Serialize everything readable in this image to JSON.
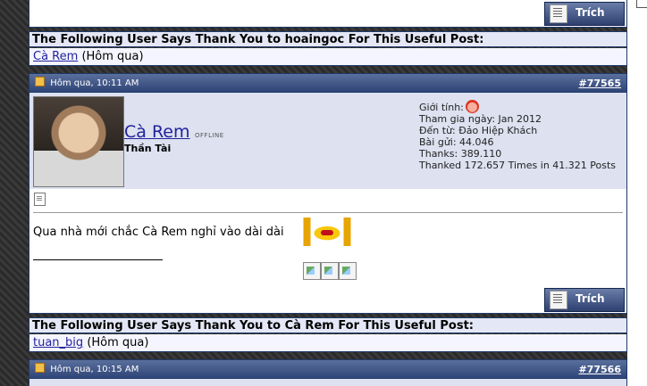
{
  "top_post": {
    "quote_button_label": "Trích"
  },
  "thanks_1": {
    "header": "The Following User Says Thank You to hoaingoc For This Useful Post:",
    "user": "Cà Rem",
    "when": "(Hôm qua)"
  },
  "post": {
    "date": "Hôm qua, 10:11 AM",
    "number_hash": "#",
    "number": "77565",
    "username": "Cà Rem",
    "status": "OFFLINE",
    "user_title": "Thần Tài",
    "info": {
      "gender_label": "Giới tính:",
      "join_date": "Tham gia ngày: Jan 2012",
      "location": "Đến từ: Đảo Hiệp Khách",
      "posts": "Bài gửi: 44.046",
      "thanks": "Thanks: 389.110",
      "thanked": "Thanked 172.657 Times in 41.321 Posts"
    },
    "message": "Qua nhà mới chắc Cà Rem nghỉ vào dài dài",
    "quote_button_label": "Trích",
    "icons": {
      "post_icon": "doc-icon",
      "emoticon": "angry-emoticon",
      "gender": "female-icon"
    }
  },
  "thanks_2": {
    "header": "The Following User Says Thank You to Cà Rem For This Useful Post:",
    "user": "tuan_big",
    "when": "(Hôm qua)"
  },
  "next_post": {
    "date": "Hôm qua, 10:15 AM",
    "number_hash": "#",
    "number": "77566"
  },
  "colors": {
    "header_bar": "#2f4577",
    "link": "#22229c",
    "userbar": "#dde1f0"
  }
}
